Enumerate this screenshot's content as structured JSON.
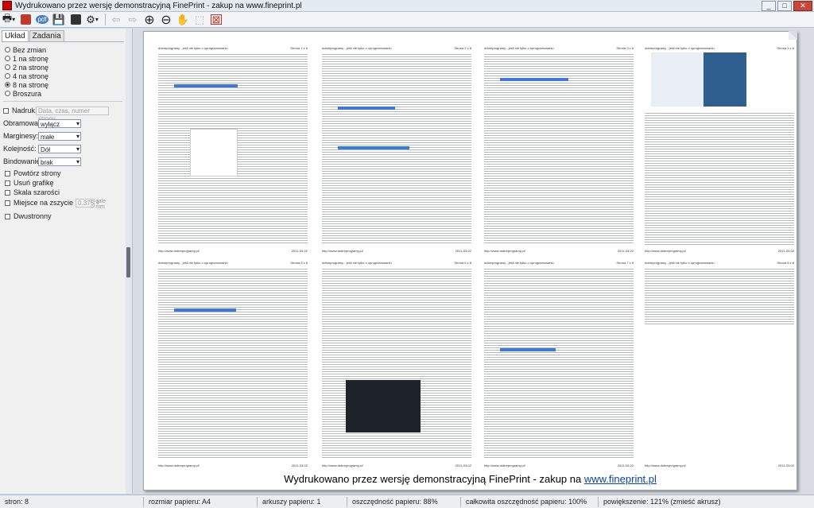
{
  "window": {
    "title": "Wydrukowano przez wersję demonstracyjną FinePrint - zakup na www.fineprint.pl"
  },
  "toolbar": {
    "pdf_label": "pdf"
  },
  "panel": {
    "tabs": [
      "Układ",
      "Zadania"
    ],
    "layout_options": [
      "Bez zmian",
      "1 na stronę",
      "2 na stronę",
      "4 na stronę",
      "8 na stronę",
      "Broszura"
    ],
    "selected_layout": "8 na stronę",
    "overlay_label": "Nadruk:",
    "overlay_value": "Data, czas, numer strony",
    "border_label": "Obramowanie",
    "border_value": "wyłącz",
    "margins_label": "Marginesy:",
    "margins_value": "małe",
    "order_label": "Kolejność:",
    "order_value": "Dół",
    "binding_label": "Bindowanie:",
    "binding_value": "brak",
    "checks": [
      "Powtórz strony",
      "Usuń grafikę",
      "Skala szarości",
      "Miejsce na zszycie"
    ],
    "gutter_value": "0.375",
    "units": [
      "cale",
      "mm"
    ],
    "duplex_label": "Dwustronny"
  },
  "preview": {
    "watermark_text": "Wydrukowano przez wersję demonstracyjną FinePrint - zakup na ",
    "watermark_link": "www.fineprint.pl",
    "sheet_header_site": "dobreprogramy - jeśli nie tylko o oprogramowaniu",
    "sheet_header_pages": [
      "Strona 1 z 8",
      "Strona 2 z 8",
      "Strona 3 z 8",
      "Strona 4 z 8",
      "Strona 5 z 8",
      "Strona 6 z 8",
      "Strona 7 z 8",
      "Strona 8 z 8"
    ],
    "sheet_footer_url": "http://www.dobreprogramy.pl/",
    "sheet_footer_date": "2011-03-02"
  },
  "status": {
    "pages": "stron: 8",
    "paper_size": "rozmiar papieru: A4",
    "sheets": "arkuszy papieru: 1",
    "paper_saving": "oszczędność papieru: 88%",
    "total_saving": "całkowita oszczędność papieru: 100%",
    "zoom": "powiększenie: 121% (zmieść akrusz)"
  },
  "colors": {
    "accent": "#3d7ad8",
    "link": "#0645ad"
  }
}
